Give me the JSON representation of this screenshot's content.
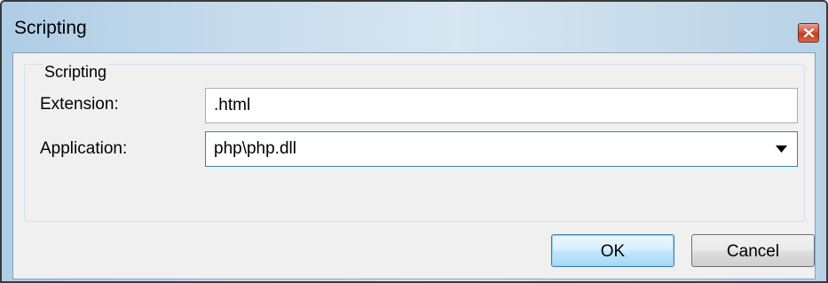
{
  "window": {
    "title": "Scripting"
  },
  "group": {
    "label": "Scripting"
  },
  "fields": {
    "extension_label": "Extension:",
    "extension_value": ".html",
    "application_label": "Application:",
    "application_value": "php\\php.dll"
  },
  "buttons": {
    "ok_label": "OK",
    "cancel_label": "Cancel"
  },
  "icons": {
    "close": "close-icon",
    "dropdown": "chevron-down-icon"
  },
  "colors": {
    "title_gradient_start": "#aecde6",
    "client_background": "#f0f0f0",
    "close_button": "#c03a21",
    "focus_border": "#3c7fb1"
  }
}
